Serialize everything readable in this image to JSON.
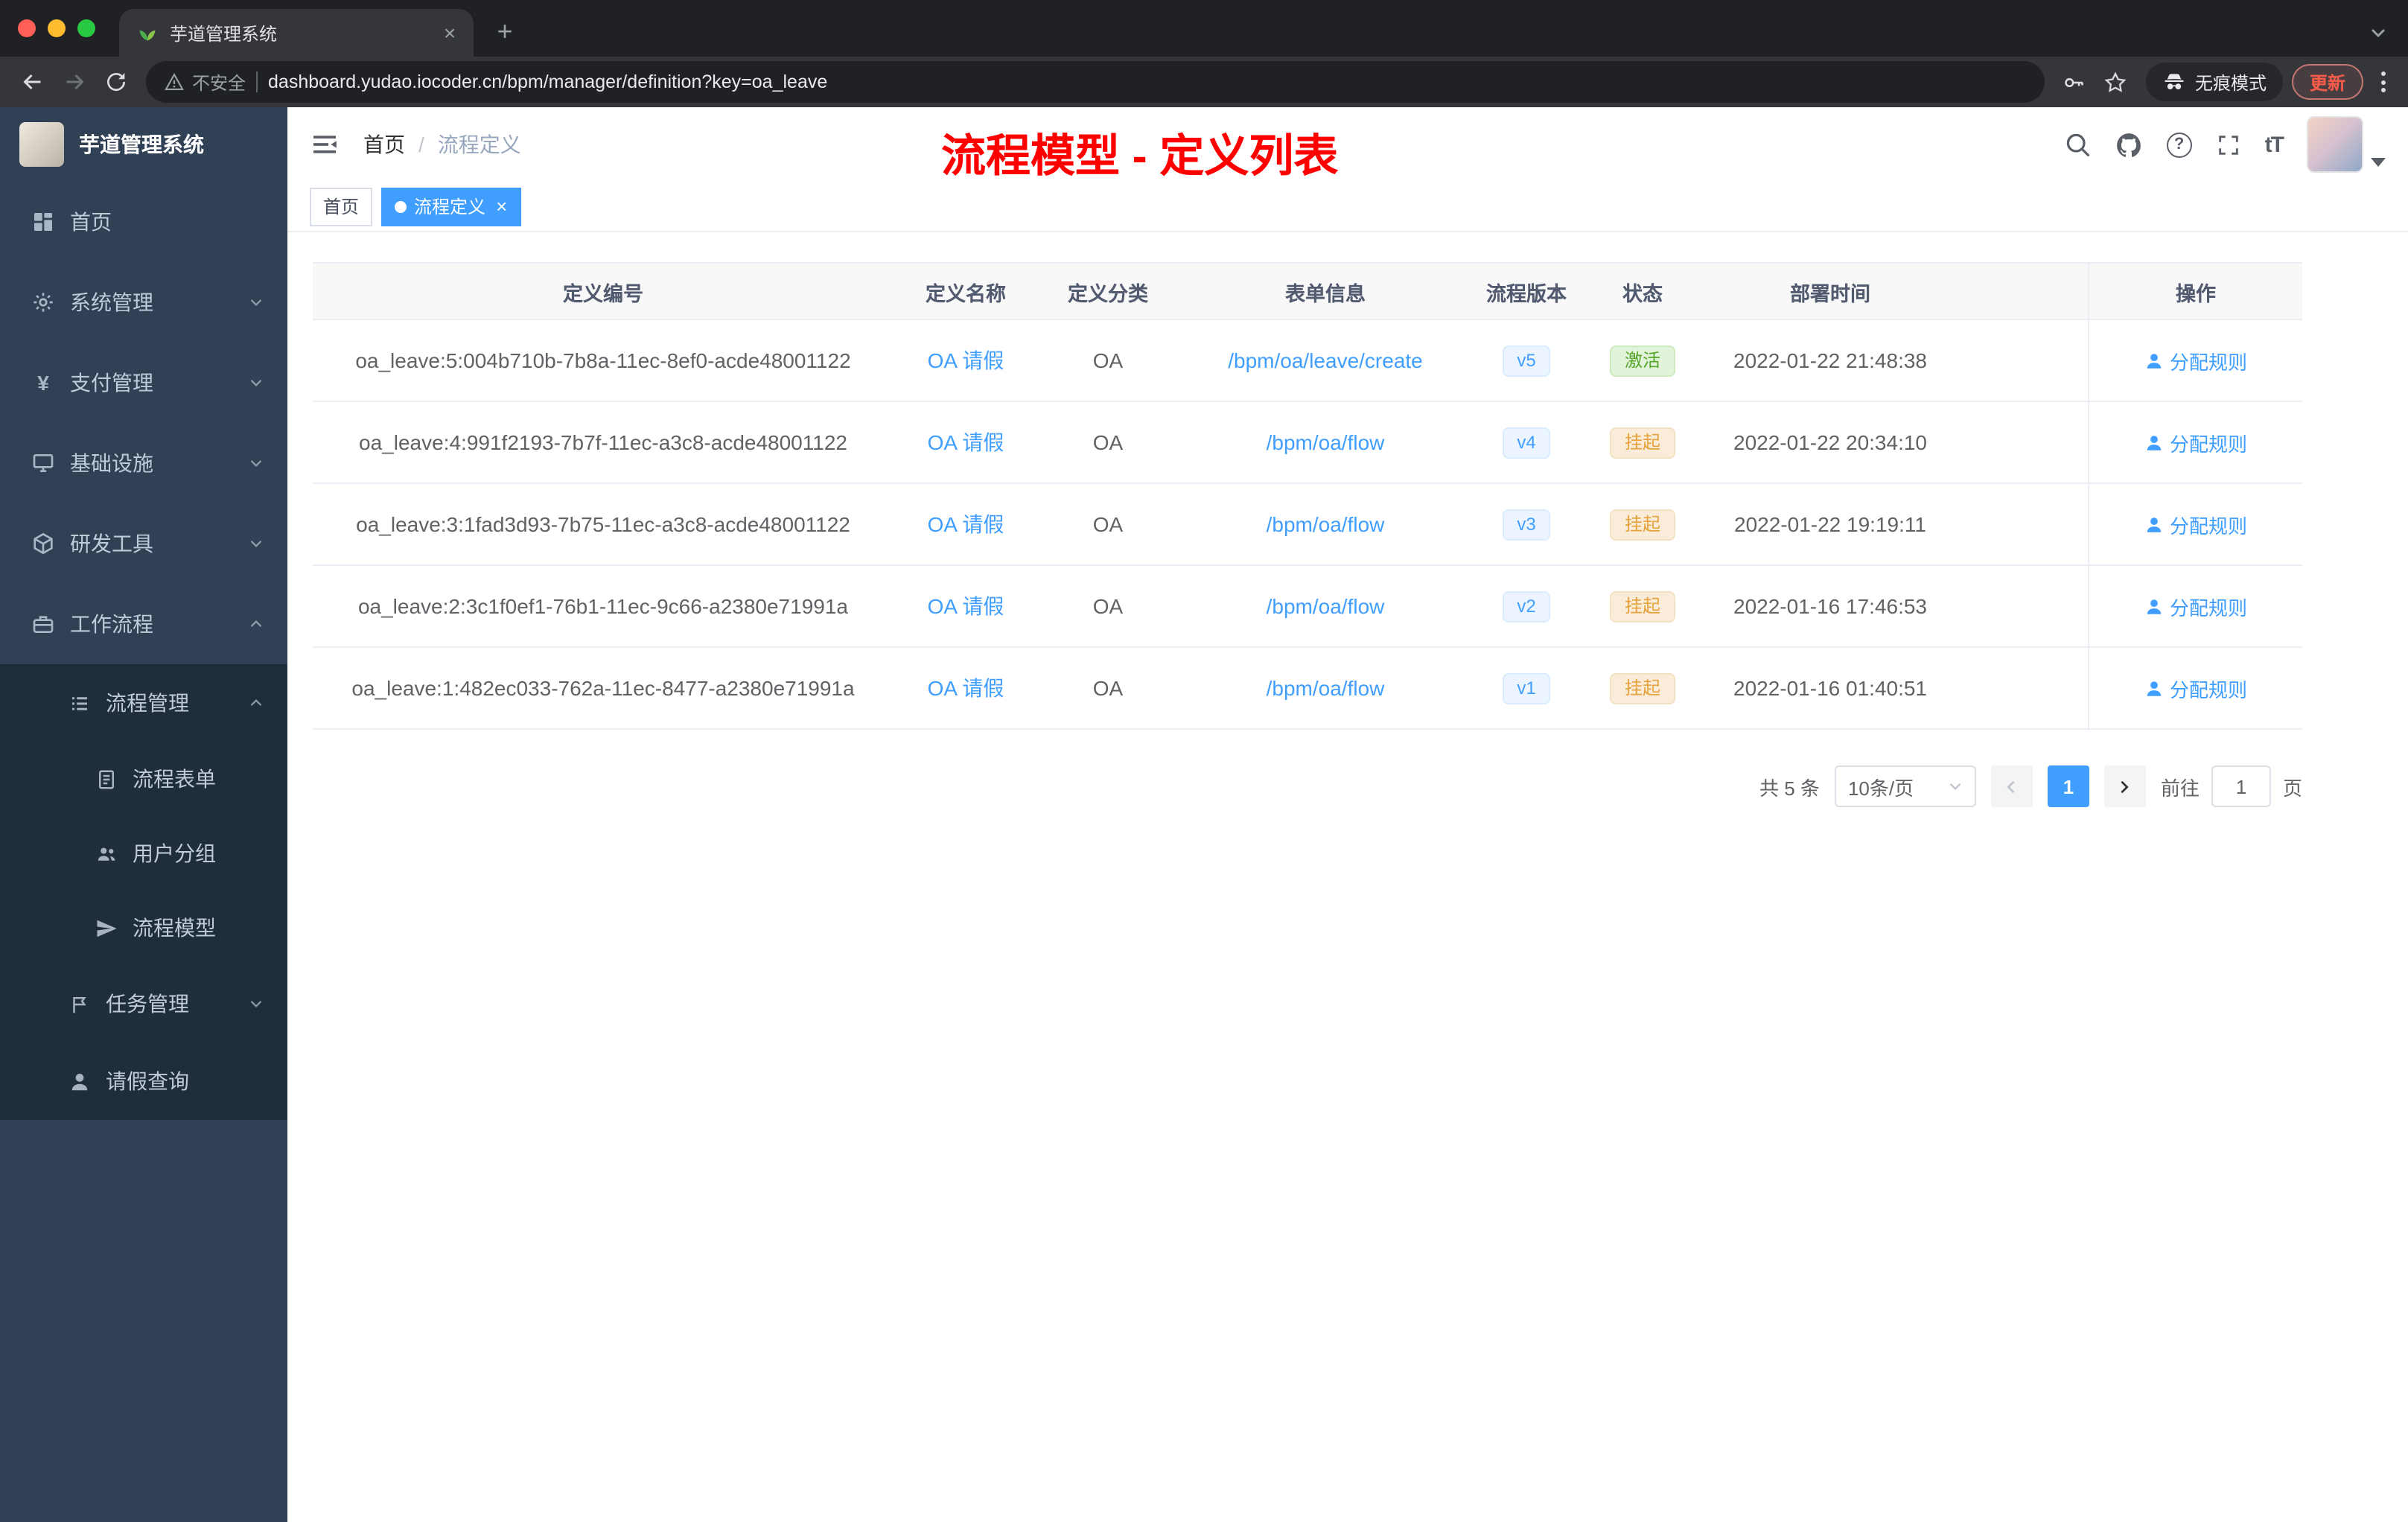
{
  "browser": {
    "tab_title": "芋道管理系统",
    "security_label": "不安全",
    "url": "dashboard.yudao.iocoder.cn/bpm/manager/definition?key=oa_leave",
    "incognito_label": "无痕模式",
    "update_label": "更新"
  },
  "glyphs": {
    "plus": "+",
    "close": "×",
    "question": "?",
    "font_size": "tT",
    "yen": "¥"
  },
  "sidebar": {
    "logo_text": "芋道管理系统",
    "items": [
      {
        "label": "首页"
      },
      {
        "label": "系统管理"
      },
      {
        "label": "支付管理"
      },
      {
        "label": "基础设施"
      },
      {
        "label": "研发工具"
      },
      {
        "label": "工作流程"
      },
      {
        "label": "流程管理"
      },
      {
        "label": "流程表单"
      },
      {
        "label": "用户分组"
      },
      {
        "label": "流程模型"
      },
      {
        "label": "任务管理"
      },
      {
        "label": "请假查询"
      }
    ]
  },
  "header": {
    "breadcrumb": {
      "home": "首页",
      "separator": "/",
      "current": "流程定义"
    },
    "annotation": "流程模型 - 定义列表"
  },
  "tags": [
    {
      "label": "首页"
    },
    {
      "label": "流程定义"
    }
  ],
  "table": {
    "columns": [
      "定义编号",
      "定义名称",
      "定义分类",
      "表单信息",
      "流程版本",
      "状态",
      "部署时间",
      "操作"
    ],
    "rows": [
      {
        "id": "oa_leave:5:004b710b-7b8a-11ec-8ef0-acde48001122",
        "name": "OA 请假",
        "category": "OA",
        "form": "/bpm/oa/leave/create",
        "version": "v5",
        "status": "激活",
        "time": "2022-01-22 21:48:38",
        "action": "分配规则"
      },
      {
        "id": "oa_leave:4:991f2193-7b7f-11ec-a3c8-acde48001122",
        "name": "OA 请假",
        "category": "OA",
        "form": "/bpm/oa/flow",
        "version": "v4",
        "status": "挂起",
        "time": "2022-01-22 20:34:10",
        "action": "分配规则"
      },
      {
        "id": "oa_leave:3:1fad3d93-7b75-11ec-a3c8-acde48001122",
        "name": "OA 请假",
        "category": "OA",
        "form": "/bpm/oa/flow",
        "version": "v3",
        "status": "挂起",
        "time": "2022-01-22 19:19:11",
        "action": "分配规则"
      },
      {
        "id": "oa_leave:2:3c1f0ef1-76b1-11ec-9c66-a2380e71991a",
        "name": "OA 请假",
        "category": "OA",
        "form": "/bpm/oa/flow",
        "version": "v2",
        "status": "挂起",
        "time": "2022-01-16 17:46:53",
        "action": "分配规则"
      },
      {
        "id": "oa_leave:1:482ec033-762a-11ec-8477-a2380e71991a",
        "name": "OA 请假",
        "category": "OA",
        "form": "/bpm/oa/flow",
        "version": "v1",
        "status": "挂起",
        "time": "2022-01-16 01:40:51",
        "action": "分配规则"
      }
    ]
  },
  "pagination": {
    "total": "共 5 条",
    "page_size": "10条/页",
    "current_page": "1",
    "goto_label": "前往",
    "goto_value": "1",
    "page_unit": "页"
  },
  "colors": {
    "accent": "#409eff",
    "success": "#67c23a",
    "warning": "#e6a23c",
    "annotation": "#ff0000",
    "sidebar_bg": "#304156"
  }
}
